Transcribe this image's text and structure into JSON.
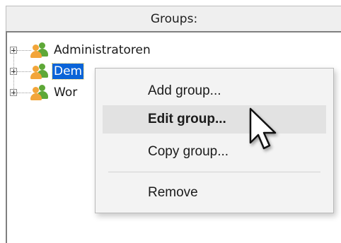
{
  "panel": {
    "header": "Groups:"
  },
  "tree": {
    "items": [
      {
        "label": "Administratoren",
        "selected": false
      },
      {
        "label": "Dem",
        "selected": true
      },
      {
        "label": "Wor",
        "selected": false
      }
    ]
  },
  "context_menu": {
    "items": [
      {
        "label": "Add group...",
        "hovered": false
      },
      {
        "label": "Edit group...",
        "hovered": true
      },
      {
        "label": "Copy group...",
        "hovered": false
      },
      {
        "label": "Remove",
        "hovered": false
      }
    ]
  },
  "colors": {
    "selection": "#0a64d8",
    "menu_background": "#f3f3f3",
    "menu_hover": "#e2e2e2",
    "group_icon_front": "#f2a53a",
    "group_icon_back": "#5ea838"
  },
  "icons": {
    "expander": "plus-box-icon",
    "group": "user-group-icon",
    "cursor": "arrow-cursor-icon"
  }
}
